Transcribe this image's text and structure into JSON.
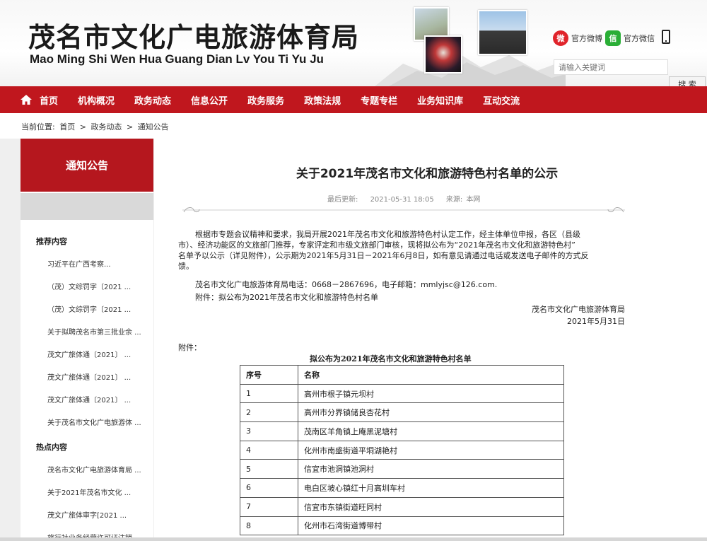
{
  "header": {
    "title_cn": "茂名市文化广电旅游体育局",
    "title_en": "Mao Ming Shi Wen Hua Guang Dian Lv You Ti Yu Ju",
    "weibo_label": "官方微博",
    "wechat_label": "官方微信",
    "search_placeholder": "请输入关键词",
    "search_button": "搜 索"
  },
  "nav": {
    "items": [
      "首页",
      "机构概况",
      "政务动态",
      "信息公开",
      "政务服务",
      "政策法规",
      "专题专栏",
      "业务知识库",
      "互动交流"
    ]
  },
  "breadcrumb": {
    "prefix": "当前位置:",
    "items": [
      "首页",
      ">",
      "政务动态",
      ">",
      "通知公告"
    ]
  },
  "sidebar": {
    "heading": "通知公告",
    "section1": "推荐内容",
    "links1": [
      "习近平在广西考察...",
      "（茂）文综罚字〔2021 ...",
      "（茂）文综罚字〔2021 ...",
      "关于拟聘茂名市第三批业余 ...",
      "茂文广旅体通〔2021〕 ...",
      "茂文广旅体通〔2021〕 ...",
      "茂文广旅体通〔2021〕 ...",
      "关于茂名市文化广电旅游体 ..."
    ],
    "section2": "热点内容",
    "links2": [
      "茂名市文化广电旅游体育局 ...",
      "关于2021年茂名市文化 ...",
      "茂文广旅体审字[2021 ...",
      "旅行社业务经营许可证注销 ..."
    ]
  },
  "article": {
    "title": "关于2021年茂名市文化和旅游特色村名单的公示",
    "updated_label": "最后更新:",
    "updated_value": "2021-05-31 18:05",
    "source_label": "来源:",
    "source_value": "本网",
    "para1_lines": [
      "根据市专题会议精神和要求，我局开展2021年茂名市文化和旅游特色村认定工作，经主体单位申报，各区（县级",
      "市）、经济功能区的文旅部门推荐，专家评定和市级文旅部门审核，现将拟公布为“2021年茂名市文化和旅游特色村”",
      "名单予以公示（详见附件），公示期为2021年5月31日－2021年6月8日，如有意见请通过电话或发送电子邮件的方式反",
      "馈。"
    ],
    "contact": "茂名市文化广电旅游体育局电话：0668－2867696，电子邮箱：mmlyjsc@126.com.",
    "attachment_line": "附件：拟公布为2021年茂名市文化和旅游特色村名单",
    "signature": "茂名市文化广电旅游体育局",
    "date": "2021年5月31日",
    "attach_label": "附件：",
    "table_title": "拟公布为2021年茂名市文化和旅游特色村名单",
    "table_headers": [
      "序号",
      "名称"
    ],
    "table_rows": [
      [
        "1",
        "高州市根子镇元坝村"
      ],
      [
        "2",
        "高州市分界镇储良杏花村"
      ],
      [
        "3",
        "茂南区羊角镇上庵黑泥塘村"
      ],
      [
        "4",
        "化州市南盛街道平垌湖艳村"
      ],
      [
        "5",
        "信宜市池洞镇池洞村"
      ],
      [
        "6",
        "电白区坡心镇红十月高圳车村"
      ],
      [
        "7",
        "信宜市东镇街道旺同村"
      ],
      [
        "8",
        "化州市石湾街道博带村"
      ]
    ]
  },
  "colors": {
    "brand_red": "#c0171e",
    "sidebar_red": "#b5171e"
  }
}
